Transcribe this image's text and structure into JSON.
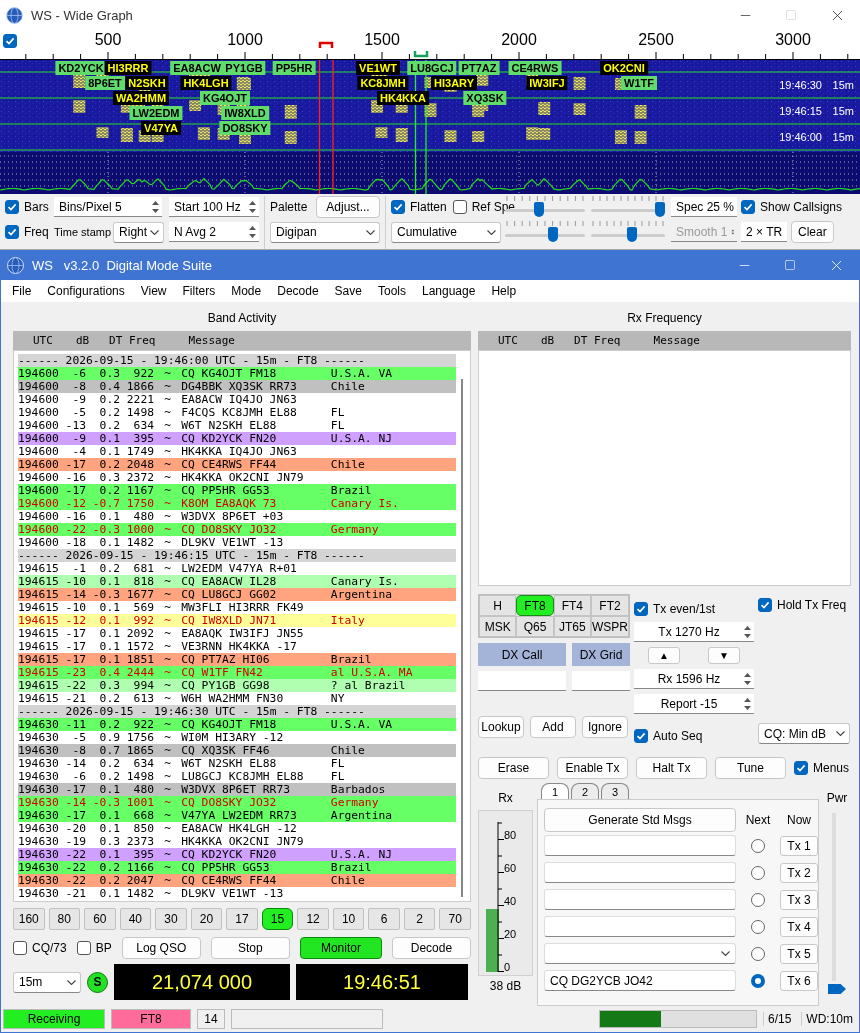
{
  "wide_graph": {
    "title": "WS - Wide Graph",
    "scale_checked": true,
    "scale_labels": [
      "500",
      "1000",
      "1500",
      "2000",
      "2500",
      "3000"
    ],
    "callsigns": [
      {
        "text": "KD2YCK",
        "kind": "cq"
      },
      {
        "text": "HI3RRR",
        "kind": "call"
      },
      {
        "text": "EA8ACW",
        "kind": "cq"
      },
      {
        "text": "PY1GB",
        "kind": "cq"
      },
      {
        "text": "PP5HR",
        "kind": "cq"
      },
      {
        "text": "VE1WT",
        "kind": "call"
      },
      {
        "text": "LU8GCJ",
        "kind": "cq"
      },
      {
        "text": "PT7AZ",
        "kind": "cq"
      },
      {
        "text": "CE4RWS",
        "kind": "cq"
      },
      {
        "text": "OK2CNI",
        "kind": "call"
      },
      {
        "text": "8P6ET",
        "kind": "cq"
      },
      {
        "text": "N2SKH",
        "kind": "call"
      },
      {
        "text": "HK4LGH",
        "kind": "call"
      },
      {
        "text": "KC8JMH",
        "kind": "call"
      },
      {
        "text": "HI3ARY",
        "kind": "call"
      },
      {
        "text": "IW3IFJ",
        "kind": "call"
      },
      {
        "text": "W1TF",
        "kind": "cq"
      },
      {
        "text": "WA2HMM",
        "kind": "call"
      },
      {
        "text": "KG4OJT",
        "kind": "cq"
      },
      {
        "text": "HK4KKA",
        "kind": "call"
      },
      {
        "text": "XQ3SK",
        "kind": "cq"
      },
      {
        "text": "LW2EDM",
        "kind": "cq"
      },
      {
        "text": "IW8XLD",
        "kind": "cq"
      },
      {
        "text": "V47YA",
        "kind": "call"
      },
      {
        "text": "DO8SKY",
        "kind": "cq"
      }
    ],
    "timestamps": [
      {
        "time": "19:46:30",
        "band": "15m"
      },
      {
        "time": "19:46:15",
        "band": "15m"
      },
      {
        "time": "19:46:00",
        "band": "15m"
      }
    ],
    "controls": {
      "bars": {
        "label": "Bars",
        "checked": true
      },
      "freq": {
        "label": "Freq",
        "checked": true
      },
      "bins_per_pixel": "Bins/Pixel  5",
      "start": "Start 100 Hz",
      "time_stamp_label": "Time stamp",
      "time_stamp": "Right",
      "n_avg": "N Avg 2",
      "palette_label": "Palette",
      "adjust": "Adjust...",
      "palette": "Digipan",
      "flatten": {
        "label": "Flatten",
        "checked": true
      },
      "ref_spec": {
        "label": "Ref Spe",
        "checked": false
      },
      "mode": "Cumulative",
      "sliders": [
        {
          "level": 0.42
        },
        {
          "level": 0.93
        },
        {
          "level": 0.6
        },
        {
          "level": 0.55
        }
      ],
      "spec": "Spec 25 %",
      "smooth": {
        "text": "Smooth  1",
        "disabled": true
      },
      "show_callsigns": {
        "label": "Show Callsigns",
        "checked": true
      },
      "tr": "2 × TR",
      "clear": "Clear"
    }
  },
  "main": {
    "title": "WS   v3.2.0  Digital Mode Suite",
    "menu": [
      "File",
      "Configurations",
      "View",
      "Filters",
      "Mode",
      "Decode",
      "Save",
      "Tools",
      "Language",
      "Help"
    ],
    "band_activity": {
      "title": "Band Activity",
      "columns": [
        "UTC",
        "dB",
        "DT",
        "Freq",
        "Message"
      ],
      "rows": [
        {
          "kind": "separator",
          "text": "------ 2026-09-15 - 19:46:00 UTC - 15m - FT8 ------"
        },
        {
          "kind": "decode",
          "utc": "194600",
          "db": "-6",
          "dt": "0.3",
          "freq": "922",
          "mark": "~",
          "message": "CQ KG4OJT FM18",
          "country": "U.S.A. VA",
          "color": "#66ff66",
          "alert": false
        },
        {
          "kind": "decode",
          "utc": "194600",
          "db": "-8",
          "dt": "0.4",
          "freq": "1866",
          "mark": "~",
          "message": "DG4BBK XQ3SK RR73",
          "country": "Chile",
          "color": "#c0c0c0",
          "alert": false
        },
        {
          "kind": "decode",
          "utc": "194600",
          "db": "-9",
          "dt": "0.2",
          "freq": "2221",
          "mark": "~",
          "message": "EA8ACW IQ4JO JN63",
          "color": "#ffffff",
          "alert": false
        },
        {
          "kind": "decode",
          "utc": "194600",
          "db": "-5",
          "dt": "0.2",
          "freq": "1498",
          "mark": "~",
          "message": "F4CQS KC8JMH EL88",
          "country": "FL",
          "color": "#ffffff",
          "alert": false
        },
        {
          "kind": "decode",
          "utc": "194600",
          "db": "-13",
          "dt": "0.2",
          "freq": "634",
          "mark": "~",
          "message": "W6T N2SKH EL88",
          "country": "FL",
          "color": "#ffffff",
          "alert": false
        },
        {
          "kind": "decode",
          "utc": "194600",
          "db": "-9",
          "dt": "0.1",
          "freq": "395",
          "mark": "~",
          "message": "CQ KD2YCK FN20",
          "country": "U.S.A. NJ",
          "color": "#d0a0ff",
          "alert": false
        },
        {
          "kind": "decode",
          "utc": "194600",
          "db": "-4",
          "dt": "0.1",
          "freq": "1749",
          "mark": "~",
          "message": "HK4KKA IQ4JO JN63",
          "color": "#ffffff",
          "alert": false
        },
        {
          "kind": "decode",
          "utc": "194600",
          "db": "-17",
          "dt": "0.2",
          "freq": "2048",
          "mark": "~",
          "message": "CQ CE4RWS FF44",
          "country": "Chile",
          "color": "#ffa47e",
          "alert": false
        },
        {
          "kind": "decode",
          "utc": "194600",
          "db": "-16",
          "dt": "0.3",
          "freq": "2372",
          "mark": "~",
          "message": "HK4KKA OK2CNI JN79",
          "color": "#ffffff",
          "alert": false
        },
        {
          "kind": "decode",
          "utc": "194600",
          "db": "-17",
          "dt": "0.2",
          "freq": "1167",
          "mark": "~",
          "message": "CQ PP5HR GG53",
          "country": "Brazil",
          "color": "#66ff66",
          "alert": false
        },
        {
          "kind": "decode",
          "utc": "194600",
          "db": "-12",
          "dt": "-0.7",
          "freq": "1750",
          "mark": "~",
          "message": "K8OM EA8AQK 73",
          "country": "Canary Is.",
          "color": "#66ff66",
          "alert": true
        },
        {
          "kind": "decode",
          "utc": "194600",
          "db": "-16",
          "dt": "0.1",
          "freq": "480",
          "mark": "~",
          "message": "W3DVX 8P6ET +03",
          "color": "#ffffff",
          "alert": false
        },
        {
          "kind": "decode",
          "utc": "194600",
          "db": "-22",
          "dt": "-0.3",
          "freq": "1000",
          "mark": "~",
          "message": "CQ DO8SKY JO32",
          "country": "Germany",
          "color": "#66ff66",
          "alert": true
        },
        {
          "kind": "decode",
          "utc": "194600",
          "db": "-18",
          "dt": "0.1",
          "freq": "1482",
          "mark": "~",
          "message": "DL9KV VE1WT -13",
          "color": "#ffffff",
          "alert": false
        },
        {
          "kind": "separator",
          "text": "------ 2026-09-15 - 19:46:15 UTC - 15m - FT8 ------"
        },
        {
          "kind": "decode",
          "utc": "194615",
          "db": "-1",
          "dt": "0.2",
          "freq": "681",
          "mark": "~",
          "message": "LW2EDM V47YA R+01",
          "color": "#ffffff",
          "alert": false
        },
        {
          "kind": "decode",
          "utc": "194615",
          "db": "-10",
          "dt": "0.1",
          "freq": "818",
          "mark": "~",
          "message": "CQ EA8ACW IL28",
          "country": "Canary Is.",
          "color": "#b0ffb0",
          "alert": false
        },
        {
          "kind": "decode",
          "utc": "194615",
          "db": "-14",
          "dt": "-0.3",
          "freq": "1677",
          "mark": "~",
          "message": "CQ LU8GCJ GG02",
          "country": "Argentina",
          "color": "#ffa47e",
          "alert": false
        },
        {
          "kind": "decode",
          "utc": "194615",
          "db": "-10",
          "dt": "0.1",
          "freq": "569",
          "mark": "~",
          "message": "MW3FLI HI3RRR FK49",
          "color": "#ffffff",
          "alert": false
        },
        {
          "kind": "decode",
          "utc": "194615",
          "db": "-12",
          "dt": "0.1",
          "freq": "992",
          "mark": "~",
          "message": "CQ IW8XLD JN71",
          "country": "Italy",
          "color": "#ffff99",
          "alert": true
        },
        {
          "kind": "decode",
          "utc": "194615",
          "db": "-17",
          "dt": "0.1",
          "freq": "2092",
          "mark": "~",
          "message": "EA8AQK IW3IFJ JN55",
          "color": "#ffffff",
          "alert": false
        },
        {
          "kind": "decode",
          "utc": "194615",
          "db": "-17",
          "dt": "0.1",
          "freq": "1572",
          "mark": "~",
          "message": "VE3RNN HK4KKA -17",
          "color": "#ffffff",
          "alert": false
        },
        {
          "kind": "decode",
          "utc": "194615",
          "db": "-17",
          "dt": "0.1",
          "freq": "1851",
          "mark": "~",
          "message": "CQ PT7AZ HI06",
          "country": "Brazil",
          "color": "#ffa47e",
          "alert": false
        },
        {
          "kind": "decode",
          "utc": "194615",
          "db": "-23",
          "dt": "0.4",
          "freq": "2444",
          "mark": "~",
          "message": "CQ W1TF FN42",
          "country": "al U.S.A. MA",
          "color": "#66ff66",
          "alert": true
        },
        {
          "kind": "decode",
          "utc": "194615",
          "db": "-22",
          "dt": "0.3",
          "freq": "994",
          "mark": "~",
          "message": "CQ PY1GB GG98",
          "country": "? al Brazil",
          "color": "#b0ffb0",
          "alert": false
        },
        {
          "kind": "decode",
          "utc": "194615",
          "db": "-21",
          "dt": "0.2",
          "freq": "613",
          "mark": "~",
          "message": "W6H WA2HMM FN30",
          "country": "NY",
          "color": "#ffffff",
          "alert": false
        },
        {
          "kind": "separator",
          "text": "------ 2026-09-15 - 19:46:30 UTC - 15m - FT8 ------"
        },
        {
          "kind": "decode",
          "utc": "194630",
          "db": "-11",
          "dt": "0.2",
          "freq": "922",
          "mark": "~",
          "message": "CQ KG4OJT FM18",
          "country": "U.S.A. VA",
          "color": "#66ff66",
          "alert": false
        },
        {
          "kind": "decode",
          "utc": "194630",
          "db": "-5",
          "dt": "0.9",
          "freq": "1756",
          "mark": "~",
          "message": "WI0M HI3ARY -12",
          "color": "#ffffff",
          "alert": false
        },
        {
          "kind": "decode",
          "utc": "194630",
          "db": "-8",
          "dt": "0.7",
          "freq": "1865",
          "mark": "~",
          "message": "CQ XQ3SK FF46",
          "country": "Chile",
          "color": "#c0c0c0",
          "alert": false
        },
        {
          "kind": "decode",
          "utc": "194630",
          "db": "-14",
          "dt": "0.2",
          "freq": "634",
          "mark": "~",
          "message": "W6T N2SKH EL88",
          "country": "FL",
          "color": "#ffffff",
          "alert": false
        },
        {
          "kind": "decode",
          "utc": "194630",
          "db": "-6",
          "dt": "0.2",
          "freq": "1498",
          "mark": "~",
          "message": "LU8GCJ KC8JMH EL88",
          "country": "FL",
          "color": "#ffffff",
          "alert": false
        },
        {
          "kind": "decode",
          "utc": "194630",
          "db": "-17",
          "dt": "0.1",
          "freq": "480",
          "mark": "~",
          "message": "W3DVX 8P6ET RR73",
          "country": "Barbados",
          "color": "#c0c0c0",
          "alert": false
        },
        {
          "kind": "decode",
          "utc": "194630",
          "db": "-14",
          "dt": "-0.3",
          "freq": "1001",
          "mark": "~",
          "message": "CQ DO8SKY JO32",
          "country": "Germany",
          "color": "#66ff66",
          "alert": true
        },
        {
          "kind": "decode",
          "utc": "194630",
          "db": "-17",
          "dt": "0.1",
          "freq": "668",
          "mark": "~",
          "message": "V47YA LW2EDM RR73",
          "country": "Argentina",
          "color": "#66ff66",
          "alert": false
        },
        {
          "kind": "decode",
          "utc": "194630",
          "db": "-20",
          "dt": "0.1",
          "freq": "850",
          "mark": "~",
          "message": "EA8ACW HK4LGH -12",
          "color": "#ffffff",
          "alert": false
        },
        {
          "kind": "decode",
          "utc": "194630",
          "db": "-19",
          "dt": "0.3",
          "freq": "2373",
          "mark": "~",
          "message": "HK4KKA OK2CNI JN79",
          "color": "#ffffff",
          "alert": false
        },
        {
          "kind": "decode",
          "utc": "194630",
          "db": "-22",
          "dt": "0.1",
          "freq": "395",
          "mark": "~",
          "message": "CQ KD2YCK FN20",
          "country": "U.S.A. NJ",
          "color": "#d0a0ff",
          "alert": false
        },
        {
          "kind": "decode",
          "utc": "194630",
          "db": "-22",
          "dt": "0.2",
          "freq": "1166",
          "mark": "~",
          "message": "CQ PP5HR GG53",
          "country": "Brazil",
          "color": "#66ff66",
          "alert": false
        },
        {
          "kind": "decode",
          "utc": "194630",
          "db": "-22",
          "dt": "0.2",
          "freq": "2047",
          "mark": "~",
          "message": "CQ CE4RWS FF44",
          "country": "Chile",
          "color": "#ffa47e",
          "alert": false
        },
        {
          "kind": "decode",
          "utc": "194630",
          "db": "-21",
          "dt": "0.1",
          "freq": "1482",
          "mark": "~",
          "message": "DL9KV VE1WT -13",
          "color": "#ffffff",
          "alert": false
        }
      ]
    },
    "rx_frequency": {
      "title": "Rx Frequency",
      "columns": [
        "UTC",
        "dB",
        "DT",
        "Freq",
        "Message"
      ]
    },
    "modes": [
      {
        "label": "H",
        "selected": false
      },
      {
        "label": "FT8",
        "selected": true
      },
      {
        "label": "FT4",
        "selected": false
      },
      {
        "label": "FT2",
        "selected": false
      },
      {
        "label": "MSK",
        "selected": false
      },
      {
        "label": "Q65",
        "selected": false
      },
      {
        "label": "JT65",
        "selected": false
      },
      {
        "label": "WSPR",
        "selected": false
      }
    ],
    "tx_even": {
      "label": "Tx even/1st",
      "checked": true
    },
    "hold_tx": {
      "label": "Hold Tx Freq",
      "checked": true
    },
    "dx_call_label": "DX Call",
    "dx_grid_label": "DX Grid",
    "tx_freq": "Tx  1270  Hz",
    "up": "▲",
    "down": "▼",
    "rx_freq": "Rx  1596  Hz",
    "report": "Report -15",
    "lookup": "Lookup",
    "add": "Add",
    "ignore": "Ignore",
    "auto_seq": {
      "label": "Auto Seq",
      "checked": true
    },
    "cq_select": "CQ: Min dB",
    "actions": [
      "Erase",
      "Enable Tx",
      "Halt Tx",
      "Tune"
    ],
    "menus": {
      "label": "Menus",
      "checked": true
    },
    "meter": {
      "label": "Rx",
      "ticks": [
        "80",
        "60",
        "40",
        "20",
        "0"
      ],
      "level": 0.42,
      "reading": "38 dB"
    },
    "msg_tabs": [
      {
        "label": "1",
        "selected": true
      },
      {
        "label": "2",
        "selected": false
      },
      {
        "label": "3",
        "selected": false
      }
    ],
    "generate": "Generate Std Msgs",
    "next_label": "Next",
    "now_label": "Now",
    "tx_messages": [
      {
        "kind": "field",
        "selected": false,
        "button": "Tx 1"
      },
      {
        "kind": "field",
        "selected": false,
        "button": "Tx 2"
      },
      {
        "kind": "field",
        "selected": false,
        "button": "Tx 3"
      },
      {
        "kind": "field",
        "selected": false,
        "button": "Tx 4"
      },
      {
        "kind": "dropdown",
        "selected": false,
        "button": "Tx 5"
      },
      {
        "kind": "field",
        "value": "CQ DG2YCB JO42",
        "selected": true,
        "button": "Tx 6"
      }
    ],
    "pwr": {
      "label": "Pwr",
      "level": 0.0
    },
    "bands": [
      {
        "label": "160",
        "selected": false
      },
      {
        "label": "80",
        "selected": false
      },
      {
        "label": "60",
        "selected": false
      },
      {
        "label": "40",
        "selected": false
      },
      {
        "label": "30",
        "selected": false
      },
      {
        "label": "20",
        "selected": false
      },
      {
        "label": "17",
        "selected": false
      },
      {
        "label": "15",
        "selected": true
      },
      {
        "label": "12",
        "selected": false
      },
      {
        "label": "10",
        "selected": false
      },
      {
        "label": "6",
        "selected": false
      },
      {
        "label": "2",
        "selected": false
      },
      {
        "label": "70",
        "selected": false
      }
    ],
    "cq73": {
      "label": "CQ/73",
      "checked": false
    },
    "bp": {
      "label": "BP",
      "checked": false
    },
    "log_qso": "Log QSO",
    "stop": "Stop",
    "monitor": {
      "label": "Monitor",
      "on": true
    },
    "decode": "Decode",
    "band_select": "15m",
    "s_badge": "S",
    "dial": "21,074 000",
    "clock": "19:46:51",
    "status": {
      "state": "Receiving",
      "mode": "FT8",
      "count": "14",
      "progress": {
        "level": 0.39
      },
      "period": "6/15",
      "wd": "WD:10m"
    }
  }
}
